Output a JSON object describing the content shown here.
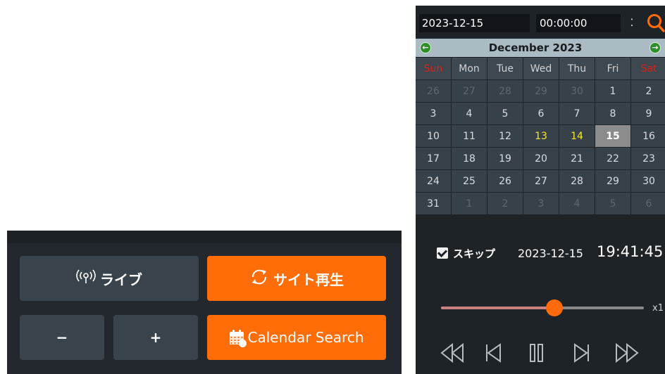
{
  "controls": {
    "live_label": "ライブ",
    "site_play_label": "サイト再生",
    "minus_label": "−",
    "plus_label": "+",
    "calendar_search_label": "Calendar Search",
    "icons": [
      "broadcast-icon",
      "refresh-icon",
      "calendar-icon"
    ]
  },
  "search": {
    "date": "2023-12-15",
    "time": "00:00:00",
    "spin_glyph": "⁚"
  },
  "calendar": {
    "month_year": "December  2023",
    "prev_glyph": "←",
    "next_glyph": "→",
    "weekdays": [
      "Sun",
      "Mon",
      "Tue",
      "Wed",
      "Thu",
      "Fri",
      "Sat"
    ],
    "weeks": [
      [
        "26",
        "27",
        "28",
        "29",
        "30",
        "1",
        "2"
      ],
      [
        "3",
        "4",
        "5",
        "6",
        "7",
        "8",
        "9"
      ],
      [
        "10",
        "11",
        "12",
        "13",
        "14",
        "15",
        "16"
      ],
      [
        "17",
        "18",
        "19",
        "20",
        "21",
        "22",
        "23"
      ],
      [
        "24",
        "25",
        "26",
        "27",
        "28",
        "29",
        "30"
      ],
      [
        "31",
        "1",
        "2",
        "3",
        "4",
        "5",
        "6"
      ]
    ],
    "leading_other_month_days": 5,
    "trailing_other_month_days": 6,
    "recorded_days": [
      "13",
      "14"
    ],
    "selected_day": "15",
    "colors": {
      "weekend_header": "#d8201a",
      "recorded": "#f7ea23",
      "selected_bg": "#8c8c8c"
    }
  },
  "playback": {
    "skip_label": "スキップ",
    "skip_checked": true,
    "timestamp_date": "2023-12-15",
    "timestamp_time": "19:41:45",
    "position": 0.56,
    "speed": "x1",
    "accent": "#ff6a0d"
  }
}
